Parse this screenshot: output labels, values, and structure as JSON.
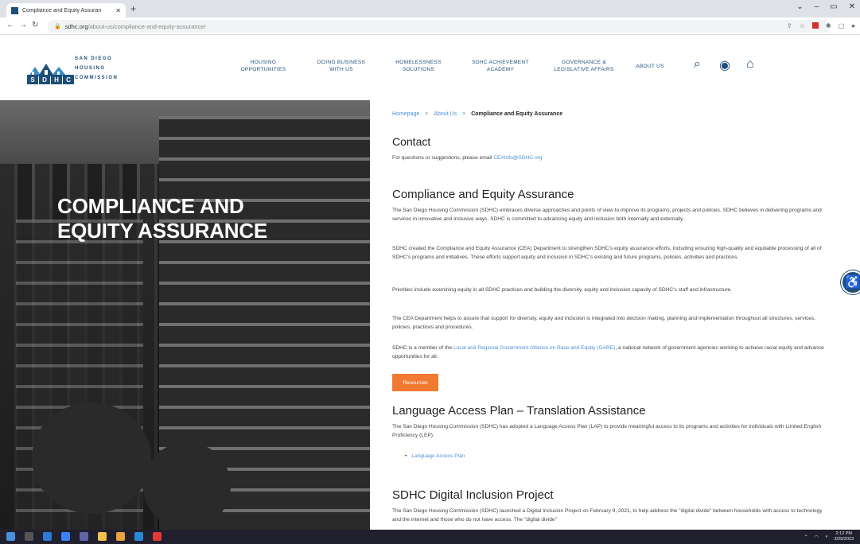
{
  "browser": {
    "tab_title": "Compliance and Equity Assuran",
    "tab_close": "✕",
    "new_tab": "+",
    "url_host": "sdhc.org",
    "url_path": "/about-us/compliance-and-equity-assurance/",
    "window_controls": [
      "⌄",
      "–",
      "▭",
      "✕"
    ]
  },
  "logo": {
    "line1": "SAN DIEGO",
    "line2": "HOUSING",
    "line3": "COMMISSION",
    "letters": [
      "S",
      "D",
      "H",
      "C"
    ]
  },
  "nav": {
    "items": [
      {
        "line1": "HOUSING",
        "line2": "OPPORTUNITIES"
      },
      {
        "line1": "DOING BUSINESS",
        "line2": "WITH US"
      },
      {
        "line1": "HOMELESSNESS",
        "line2": "SOLUTIONS"
      },
      {
        "line1": "SDHC ACHIEVEMENT",
        "line2": "ACADEMY"
      },
      {
        "line1": "GOVERNANCE &",
        "line2": "LEGISLATIVE AFFAIRS"
      },
      {
        "line1": "ABOUT US",
        "line2": ""
      }
    ]
  },
  "hero": {
    "title_line1": "COMPLIANCE AND",
    "title_line2": "EQUITY ASSURANCE"
  },
  "breadcrumb": {
    "home": "Homepage",
    "about": "About Us",
    "current": "Compliance and Equity Assurance",
    "sep": ">"
  },
  "contact": {
    "heading": "Contact",
    "text": "For questions or suggestions, please email ",
    "email": "CEAInfo@SDHC.org"
  },
  "cea": {
    "heading": "Compliance and Equity Assurance",
    "p1": "The San Diego Housing Commission (SDHC) embraces diverse approaches and points of view to improve its programs, projects and policies. SDHC believes in delivering programs and services in innovative and inclusive ways. SDHC is committed to advancing equity and inclusion both internally and externally.",
    "p2": "SDHC created the Compliance and Equity Assurance (CEA) Department to strengthen SDHC's equity assurance efforts, including ensuring high-quality and equitable processing of all of SDHC's programs and initiatives. These efforts support equity and inclusion in SDHC's existing and future programs, policies, activities and practices.",
    "p3": "Priorities include examining equity in all SDHC practices and building the diversity, equity and inclusion capacity of SDHC's staff and infrastructure.",
    "p4": "The CEA Department helps to assure that support for diversity, equity and inclusion is integrated into decision making, planning and implementation throughout all structures, services, policies, practices and procedures.",
    "p5_pre": "SDHC is a member of the ",
    "p5_link": "Local and Regional Government Alliance on Race and Equity (GARE)",
    "p5_post": ", a national network of government agencies working to achieve racial equity and advance opportunities for all.",
    "button": "Resources"
  },
  "lap": {
    "heading": "Language Access Plan – Translation Assistance",
    "text": "The San Diego Housing Commission (SDHC) has adopted a Language Access Plan (LAP) to provide meaningful access to its programs and activities for individuals with Limited English Proficiency (LEP).",
    "link": "Language Access Plan"
  },
  "dip": {
    "heading": "SDHC Digital Inclusion Project",
    "text": "The San Diego Housing Commission (SDHC) launched a Digital Inclusion Project on February 9, 2021, to help address the \"digital divide\" between households with access to technology and the internet and those who do not have access. The \"digital divide\""
  },
  "taskbar": {
    "time": "2:12 PM",
    "date": "3/29/2023"
  },
  "colors": {
    "brand": "#1f4e79",
    "link": "#4a90d9",
    "button": "#f07a32"
  }
}
